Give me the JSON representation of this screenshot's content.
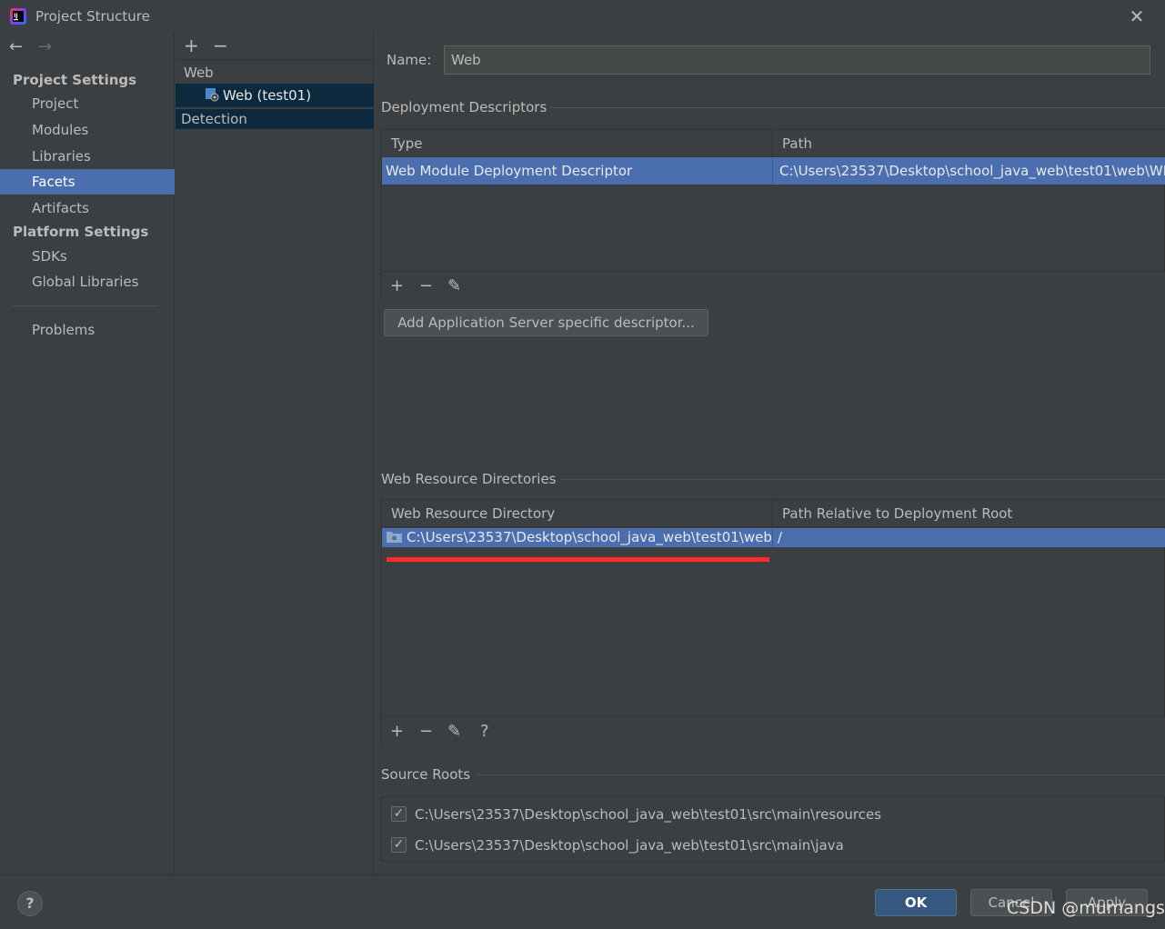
{
  "window": {
    "title": "Project Structure"
  },
  "left_nav": {
    "project_settings_heading": "Project Settings",
    "project_items": [
      {
        "label": "Project"
      },
      {
        "label": "Modules"
      },
      {
        "label": "Libraries"
      },
      {
        "label": "Facets",
        "selected": true
      },
      {
        "label": "Artifacts"
      }
    ],
    "platform_settings_heading": "Platform Settings",
    "platform_items": [
      {
        "label": "SDKs"
      },
      {
        "label": "Global Libraries"
      }
    ],
    "problems": "Problems"
  },
  "middle": {
    "group_label": "Web",
    "facet_label": "Web (test01)",
    "detection_label": "Detection"
  },
  "right": {
    "name_label": "Name:",
    "name_value": "Web",
    "deploy_section_title": "Deployment Descriptors",
    "deploy_table": {
      "headers": [
        "Type",
        "Path"
      ],
      "rows": [
        [
          "Web Module Deployment Descriptor",
          "C:\\Users\\23537\\Desktop\\school_java_web\\test01\\web\\WE"
        ]
      ]
    },
    "add_server_button": "Add Application Server specific descriptor...",
    "web_resource_section_title": "Web Resource Directories",
    "web_resource_table": {
      "headers": [
        "Web Resource Directory",
        "Path Relative to Deployment Root"
      ],
      "rows": [
        [
          "C:\\Users\\23537\\Desktop\\school_java_web\\test01\\web",
          "/"
        ]
      ]
    },
    "source_roots_section_title": "Source Roots",
    "source_roots": [
      {
        "checked": true,
        "path": "C:\\Users\\23537\\Desktop\\school_java_web\\test01\\src\\main\\resources"
      },
      {
        "checked": true,
        "path": "C:\\Users\\23537\\Desktop\\school_java_web\\test01\\src\\main\\java"
      }
    ]
  },
  "bottom": {
    "help": "?",
    "ok": "OK",
    "cancel": "Cancel",
    "apply": "Apply",
    "watermark": "CSDN @mumangs"
  },
  "colors": {
    "background": "#3c3f41",
    "selection": "#4b6eaf",
    "tree_selection": "#0d293e",
    "ok_button": "#365880",
    "highlight_underline": "#ff2b2b"
  }
}
